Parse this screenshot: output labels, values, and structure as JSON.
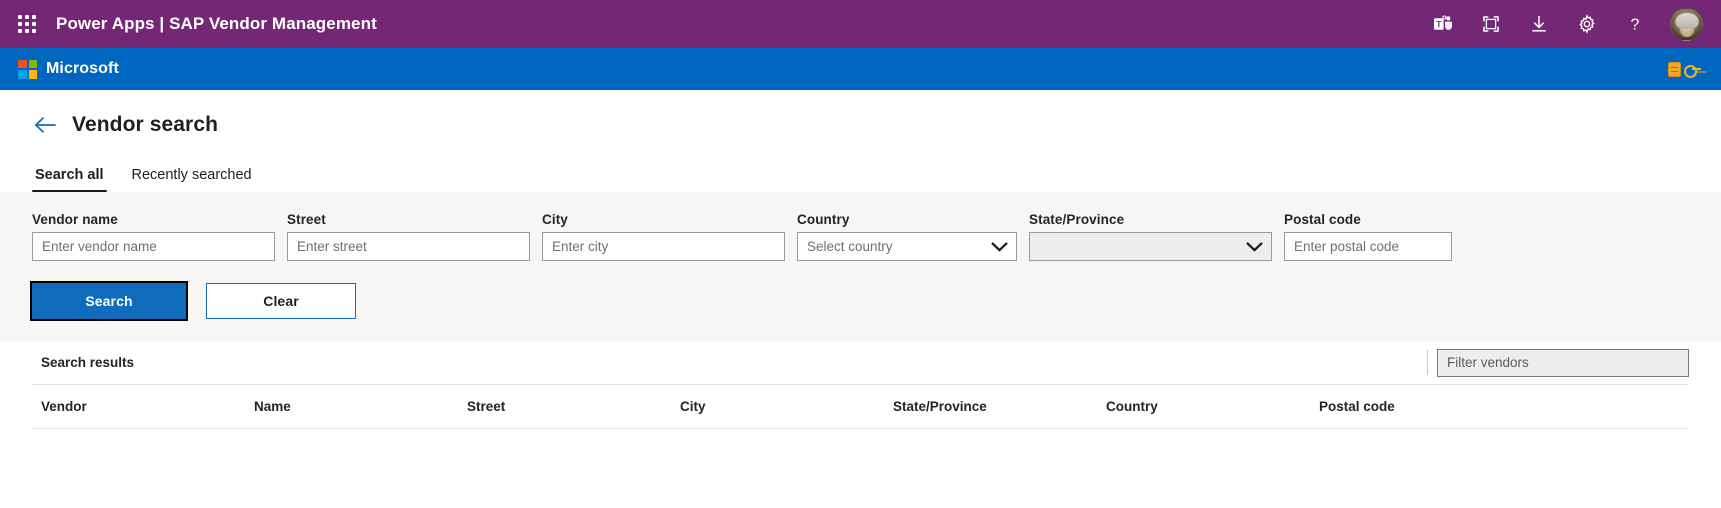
{
  "suite_bar": {
    "waffle_label": "app-launcher",
    "app_name": "Power Apps",
    "separator": "|",
    "env_name": "SAP Vendor Management",
    "title": "Power Apps  |  SAP Vendor Management",
    "icons": [
      {
        "name": "teams-icon",
        "glyph": "teams"
      },
      {
        "name": "fullscreen-icon",
        "glyph": "fullscreen"
      },
      {
        "name": "download-icon",
        "glyph": "download"
      },
      {
        "name": "settings-gear-icon",
        "glyph": "gear"
      },
      {
        "name": "help-icon",
        "glyph": "?"
      }
    ],
    "avatar_label": "user-avatar",
    "background": "#742774"
  },
  "ms_bar": {
    "brand": "Microsoft",
    "background": "#0067c0",
    "right_icon": "cookie-key-icon"
  },
  "page": {
    "back_label": "back-arrow",
    "title": "Vendor search"
  },
  "tabs": [
    {
      "label": "Search all",
      "active": true
    },
    {
      "label": "Recently searched",
      "active": false
    }
  ],
  "search_form": {
    "fields": [
      {
        "label": "Vendor name",
        "placeholder": "Enter vendor name",
        "value": "",
        "type": "text"
      },
      {
        "label": "Street",
        "placeholder": "Enter street",
        "value": "",
        "type": "text"
      },
      {
        "label": "City",
        "placeholder": "Enter city",
        "value": "",
        "type": "text"
      },
      {
        "label": "Country",
        "placeholder": "Select country",
        "value": "",
        "type": "select",
        "disabled": false
      },
      {
        "label": "State/Province",
        "placeholder": "",
        "value": "",
        "type": "select",
        "disabled": true
      },
      {
        "label": "Postal code",
        "placeholder": "Enter postal code",
        "value": "",
        "type": "text"
      }
    ],
    "buttons": {
      "search": "Search",
      "clear": "Clear"
    }
  },
  "results": {
    "title": "Search results",
    "filter_placeholder": "Filter vendors",
    "filter_value": "",
    "columns": [
      "Vendor",
      "Name",
      "Street",
      "City",
      "State/Province",
      "Country",
      "Postal code"
    ],
    "rows": []
  },
  "colors": {
    "suite_purple": "#742774",
    "ms_blue": "#0067c0",
    "accent_blue": "#0f6cbd",
    "panel_grey": "#f7f6f5",
    "disabled_grey": "#eeedec"
  }
}
